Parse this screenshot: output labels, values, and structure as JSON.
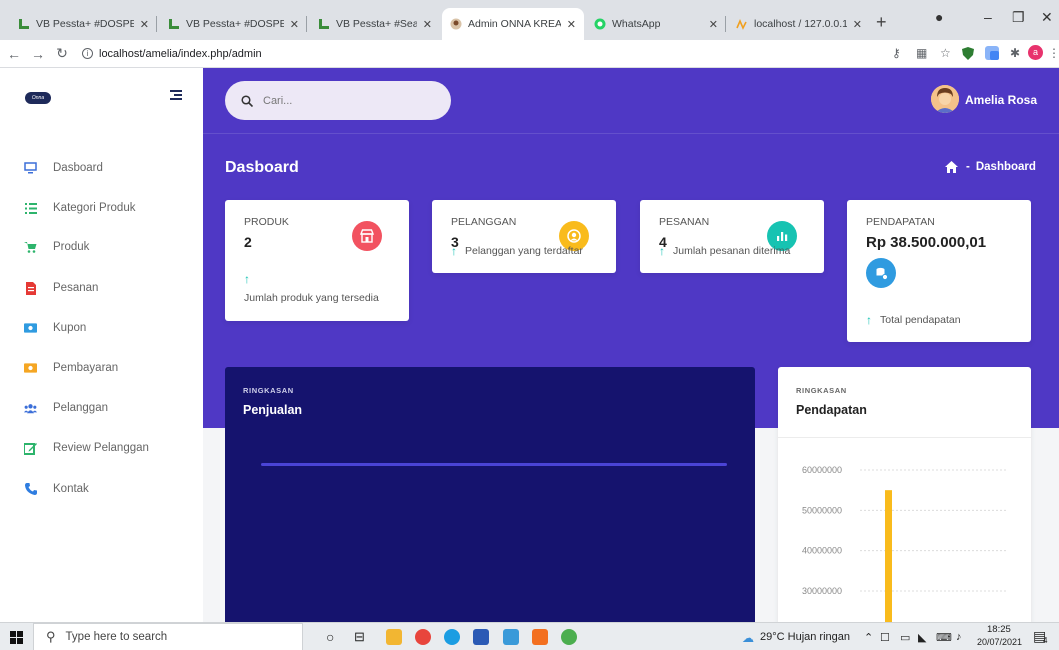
{
  "browser": {
    "tabs": [
      {
        "title": "VB Pessta+ #DOSPEM",
        "active": false
      },
      {
        "title": "VB Pessta+ #DOSPEM",
        "active": false
      },
      {
        "title": "VB Pessta+ #Search Vi",
        "active": false
      },
      {
        "title": "Admin ONNA KREASI",
        "active": true
      },
      {
        "title": "WhatsApp",
        "active": false
      },
      {
        "title": "localhost / 127.0.0.1 /",
        "active": false
      }
    ],
    "url": "localhost/amelia/index.php/admin"
  },
  "sidebar": {
    "logo_text": "Onna",
    "items": [
      {
        "label": "Dasboard",
        "icon": "monitor-icon",
        "color": "#3c6fd8"
      },
      {
        "label": "Kategori Produk",
        "icon": "list-icon",
        "color": "#2db46c"
      },
      {
        "label": "Produk",
        "icon": "cart-icon",
        "color": "#2db46c"
      },
      {
        "label": "Pesanan",
        "icon": "document-icon",
        "color": "#e53935"
      },
      {
        "label": "Kupon",
        "icon": "ticket-icon",
        "color": "#2f9be0"
      },
      {
        "label": "Pembayaran",
        "icon": "money-icon",
        "color": "#f5a623"
      },
      {
        "label": "Pelanggan",
        "icon": "users-icon",
        "color": "#3c6fd8"
      },
      {
        "label": "Review Pelanggan",
        "icon": "edit-icon",
        "color": "#2db46c"
      },
      {
        "label": "Kontak",
        "icon": "phone-icon",
        "color": "#2f7de0"
      }
    ]
  },
  "header": {
    "search_placeholder": "Cari...",
    "user_name": "Amelia Rosa"
  },
  "page": {
    "title": "Dasboard",
    "breadcrumb": "Dashboard",
    "breadcrumb_sep": "-"
  },
  "stats": [
    {
      "label": "PRODUK",
      "value": "2",
      "desc": "Jumlah produk yang tersedia",
      "icon": "store-icon",
      "color": "#f25260"
    },
    {
      "label": "PELANGGAN",
      "value": "3",
      "desc": "Pelanggan yang terdaftar",
      "icon": "user-circle-icon",
      "color": "#f9bb1c"
    },
    {
      "label": "PESANAN",
      "value": "4",
      "desc": "Jumlah pesanan diterima",
      "icon": "bar-chart-icon",
      "color": "#17c3b2"
    },
    {
      "label": "PENDAPATAN",
      "value": "Rp 38.500.000,01",
      "desc": "Total pendapatan",
      "icon": "database-icon",
      "color": "#2f9be0"
    }
  ],
  "panels": {
    "sales": {
      "caption": "RINGKASAN",
      "title": "Penjualan"
    },
    "income": {
      "caption": "RINGKASAN",
      "title": "Pendapatan"
    }
  },
  "chart_data": {
    "type": "bar",
    "title": "Pendapatan",
    "xlabel": "",
    "ylabel": "",
    "yticks": [
      60000000,
      50000000,
      40000000,
      30000000
    ],
    "ylim": [
      25000000,
      65000000
    ],
    "categories": [
      ""
    ],
    "values": [
      55000000
    ],
    "bar_color": "#f9bb1c",
    "grid": true
  },
  "taskbar": {
    "search_placeholder": "Type here to search",
    "weather": "29°C  Hujan ringan",
    "time": "18:25",
    "date": "20/07/2021",
    "notif_count": "4"
  }
}
